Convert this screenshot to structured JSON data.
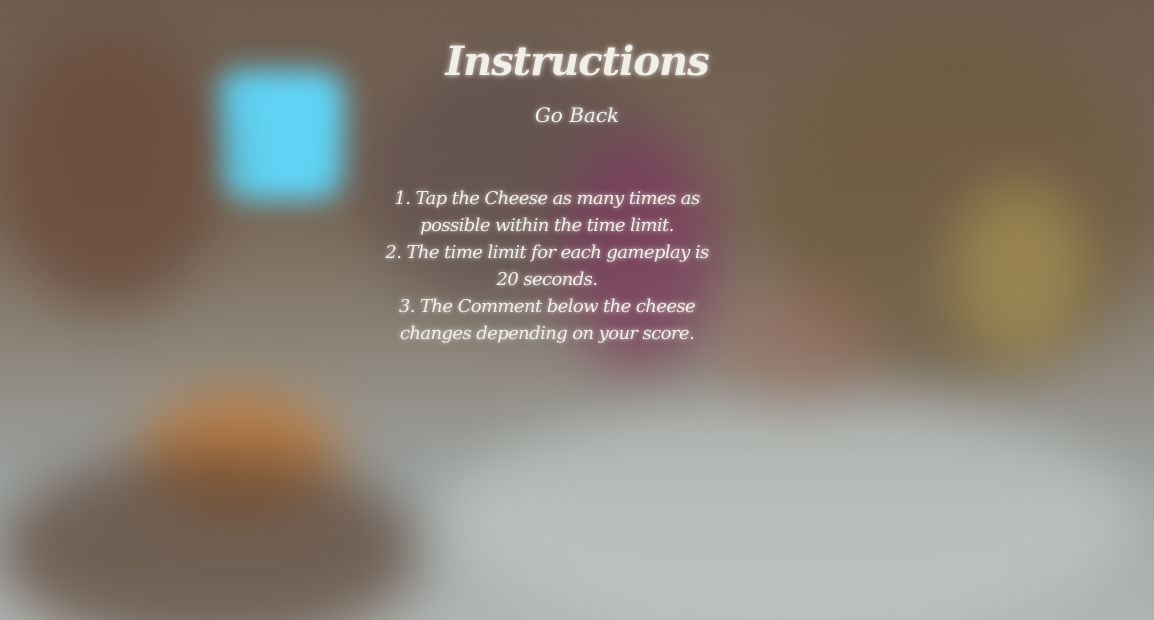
{
  "page": {
    "title": "Instructions",
    "go_back_label": "Go Back"
  },
  "instructions": [
    "1. Tap the Cheese as many times as possible within the time limit.",
    "2. The time limit for each gameplay is 20 seconds.",
    "3. The Comment below  the cheese changes depending on your score."
  ],
  "colors": {
    "text": "#f2efe9",
    "background_top": "#6d5c4f",
    "background_bottom": "#aeb4b2",
    "accent_window": "#5fd4f5"
  }
}
